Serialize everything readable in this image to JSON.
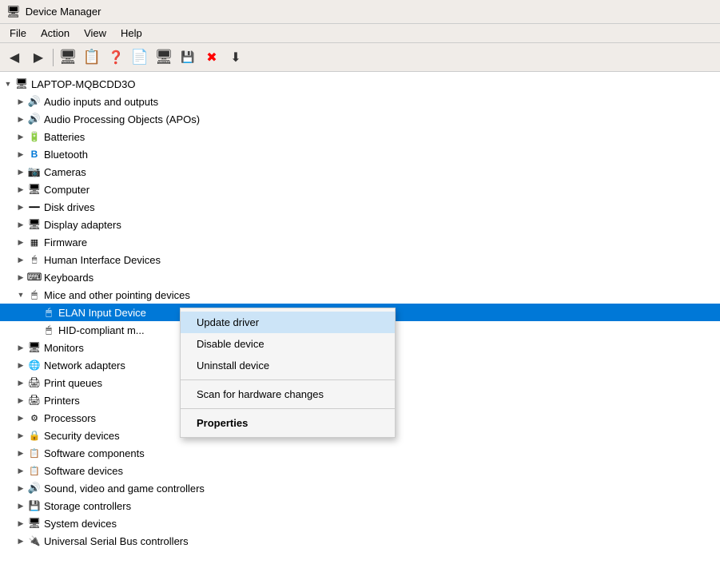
{
  "titleBar": {
    "icon": "🖥",
    "title": "Device Manager"
  },
  "menuBar": {
    "items": [
      "File",
      "Action",
      "View",
      "Help"
    ]
  },
  "toolbar": {
    "buttons": [
      "◀",
      "▶",
      "🖥",
      "📋",
      "❓",
      "📄",
      "🖥",
      "💾",
      "✖",
      "⬇"
    ]
  },
  "tree": {
    "rootLabel": "LAPTOP-MQBCDD3O",
    "items": [
      {
        "label": "Audio inputs and outputs",
        "indent": 1,
        "icon": "🔊",
        "toggle": "▶"
      },
      {
        "label": "Audio Processing Objects (APOs)",
        "indent": 1,
        "icon": "🔊",
        "toggle": "▶"
      },
      {
        "label": "Batteries",
        "indent": 1,
        "icon": "🔋",
        "toggle": "▶"
      },
      {
        "label": "Bluetooth",
        "indent": 1,
        "icon": "🔵",
        "toggle": "▶"
      },
      {
        "label": "Cameras",
        "indent": 1,
        "icon": "📷",
        "toggle": "▶"
      },
      {
        "label": "Computer",
        "indent": 1,
        "icon": "🖥",
        "toggle": "▶"
      },
      {
        "label": "Disk drives",
        "indent": 1,
        "icon": "💾",
        "toggle": "▶"
      },
      {
        "label": "Display adapters",
        "indent": 1,
        "icon": "🖥",
        "toggle": "▶"
      },
      {
        "label": "Firmware",
        "indent": 1,
        "icon": "📋",
        "toggle": "▶"
      },
      {
        "label": "Human Interface Devices",
        "indent": 1,
        "icon": "🖱",
        "toggle": "▶"
      },
      {
        "label": "Keyboards",
        "indent": 1,
        "icon": "⌨",
        "toggle": "▶"
      },
      {
        "label": "Mice and other pointing devices",
        "indent": 1,
        "icon": "🖱",
        "toggle": "▼",
        "expanded": true
      },
      {
        "label": "ELAN Input Device",
        "indent": 2,
        "icon": "🖱",
        "selected": true
      },
      {
        "label": "HID-compliant m...",
        "indent": 2,
        "icon": "🖱"
      },
      {
        "label": "Monitors",
        "indent": 1,
        "icon": "🖥",
        "toggle": "▶"
      },
      {
        "label": "Network adapters",
        "indent": 1,
        "icon": "🌐",
        "toggle": "▶"
      },
      {
        "label": "Print queues",
        "indent": 1,
        "icon": "🖨",
        "toggle": "▶"
      },
      {
        "label": "Printers",
        "indent": 1,
        "icon": "🖨",
        "toggle": "▶"
      },
      {
        "label": "Processors",
        "indent": 1,
        "icon": "⚙",
        "toggle": "▶"
      },
      {
        "label": "Security devices",
        "indent": 1,
        "icon": "🔒",
        "toggle": "▶"
      },
      {
        "label": "Software components",
        "indent": 1,
        "icon": "📋",
        "toggle": "▶"
      },
      {
        "label": "Software devices",
        "indent": 1,
        "icon": "📋",
        "toggle": "▶"
      },
      {
        "label": "Sound, video and game controllers",
        "indent": 1,
        "icon": "🔊",
        "toggle": "▶"
      },
      {
        "label": "Storage controllers",
        "indent": 1,
        "icon": "💾",
        "toggle": "▶"
      },
      {
        "label": "System devices",
        "indent": 1,
        "icon": "🖥",
        "toggle": "▶"
      },
      {
        "label": "Universal Serial Bus controllers",
        "indent": 1,
        "icon": "🔌",
        "toggle": "▶"
      }
    ]
  },
  "contextMenu": {
    "items": [
      {
        "label": "Update driver",
        "type": "item",
        "highlighted": true
      },
      {
        "label": "Disable device",
        "type": "item"
      },
      {
        "label": "Uninstall device",
        "type": "item"
      },
      {
        "type": "separator"
      },
      {
        "label": "Scan for hardware changes",
        "type": "item"
      },
      {
        "type": "separator"
      },
      {
        "label": "Properties",
        "type": "item",
        "bold": true
      }
    ]
  }
}
